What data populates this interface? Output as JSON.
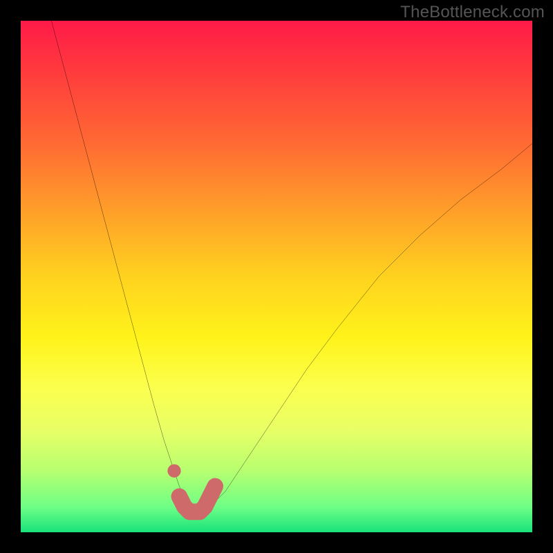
{
  "watermark": "TheBottleneck.com",
  "chart_data": {
    "type": "line",
    "title": "",
    "xlabel": "",
    "ylabel": "",
    "xlim": [
      0,
      100
    ],
    "ylim": [
      0,
      100
    ],
    "grid": false,
    "legend": false,
    "series": [
      {
        "name": "curve",
        "x": [
          6,
          10,
          14,
          18,
          22,
          26,
          28,
          30,
          31,
          32,
          33,
          34,
          35,
          36,
          37,
          38,
          40,
          42,
          46,
          50,
          56,
          62,
          70,
          78,
          86,
          94,
          100
        ],
        "y": [
          100,
          85,
          70,
          55,
          40,
          25,
          18,
          12,
          9,
          7,
          5,
          4,
          4,
          4,
          5,
          6,
          8,
          11,
          17,
          23,
          32,
          40,
          50,
          58,
          65,
          71,
          76
        ]
      }
    ],
    "highlight_points": {
      "name": "markers",
      "x": [
        30,
        31,
        32,
        33,
        34,
        35,
        36,
        37,
        38
      ],
      "y": [
        12,
        7,
        5,
        4,
        4,
        4,
        5,
        7,
        9
      ]
    },
    "colors": {
      "curve": "#000000",
      "markers": "#cf6a6a",
      "gradient_top": "#ff1a48",
      "gradient_bottom": "#18e27a"
    }
  }
}
